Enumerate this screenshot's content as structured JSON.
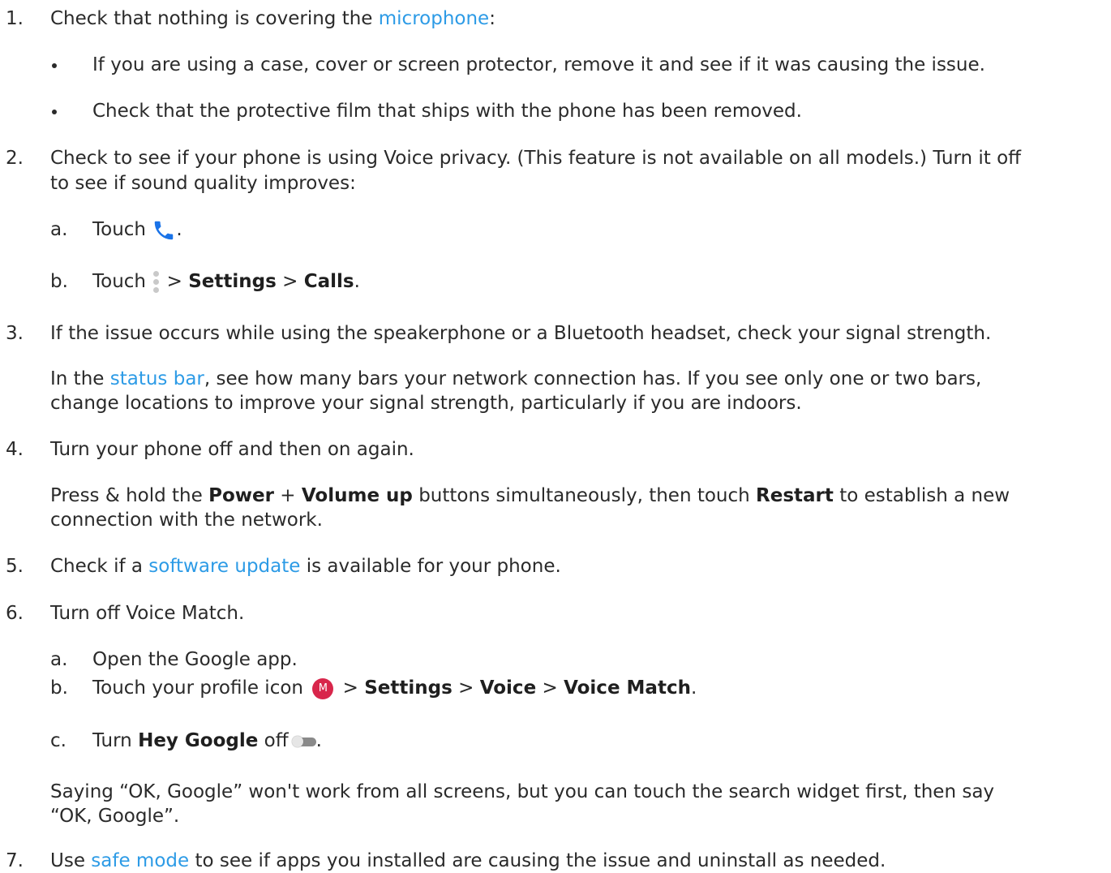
{
  "steps": [
    {
      "num": "1.",
      "pre": "Check that nothing is covering the ",
      "link": "microphone",
      "post": ":"
    },
    {
      "bullets": [
        "If you are using a case, cover or screen protector, remove it and see if it was causing the issue.",
        "Check that the protective film that ships with the phone has been removed."
      ]
    },
    {
      "num": "2.",
      "line1": "Check to see if your phone is using Voice privacy. (This feature is not available on all models.) Turn it off",
      "line2": "to see if sound quality improves:"
    },
    {
      "a_label": "a.",
      "a_text": "Touch ",
      "a_end": ".",
      "b_label": "b.",
      "b_text": "Touch ",
      "b_sep1": " > ",
      "b_settings": "Settings",
      "b_sep2": " > ",
      "b_calls": "Calls",
      "b_end": "."
    },
    {
      "num": "3.",
      "text": "If the issue occurs while using the speakerphone or a Bluetooth headset, check your signal strength.",
      "p_pre": "In the ",
      "p_link": "status bar",
      "p_post": ", see how many bars your network connection has. If you see only one or two bars,",
      "p_line2": "change locations to improve your signal strength, particularly if you are indoors."
    },
    {
      "num": "4.",
      "text": "Turn your phone off and then on again.",
      "p_pre": "Press & hold the ",
      "p_power": "Power",
      "p_plus": " + ",
      "p_vol": "Volume up",
      "p_mid": " buttons simultaneously, then touch ",
      "p_restart": "Restart",
      "p_post": " to establish a new",
      "p_line2": "connection with the network."
    },
    {
      "num": "5.",
      "pre": "Check if a ",
      "link": "software update",
      "post": " is available for your phone."
    },
    {
      "num": "6.",
      "text": "Turn off Voice Match.",
      "a_label": "a.",
      "a_text": "Open the Google app.",
      "b_label": "b.",
      "b_text": "Touch your profile icon ",
      "avatar_letter": "M",
      "b_sep": " > ",
      "b_settings": "Settings",
      "b_voice": "Voice",
      "b_vm": "Voice Match",
      "b_end": ".",
      "c_label": "c.",
      "c_text": "Turn ",
      "c_bold": "Hey Google",
      "c_post": " off",
      "c_end": ".",
      "p_line1": "Saying “OK, Google” won't work from all screens, but you can touch the search widget first, then say",
      "p_line2": "“OK, Google”."
    },
    {
      "num": "7.",
      "pre": "Use ",
      "link": "safe mode",
      "post": " to see if apps you installed are causing the issue and uninstall as needed."
    }
  ]
}
